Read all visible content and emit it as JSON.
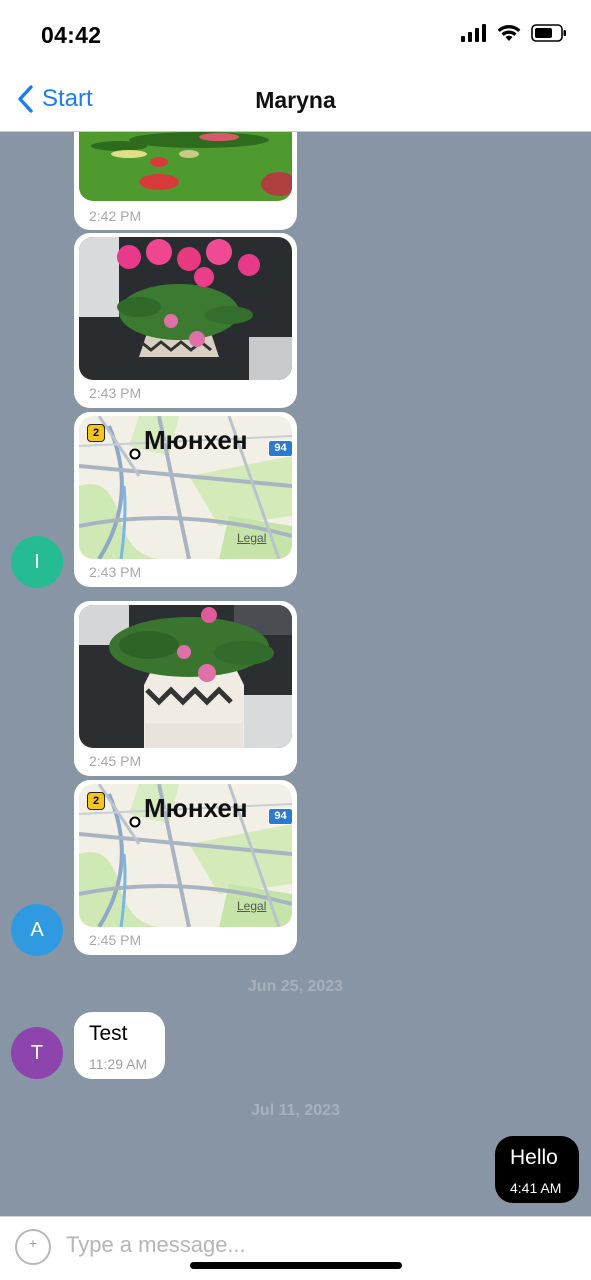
{
  "status_bar": {
    "time": "04:42"
  },
  "nav": {
    "back_label": "Start",
    "title": "Maryna"
  },
  "messages": [
    {
      "kind": "image-park",
      "time": "2:42 PM"
    },
    {
      "kind": "image-flower",
      "time": "2:43 PM"
    },
    {
      "kind": "map",
      "map_city": "Мюнхен",
      "map_badge_left": "2",
      "map_badge_right": "94",
      "map_legal": "Legal",
      "time": "2:43 PM"
    },
    {
      "kind": "image-flower",
      "time": "2:45 PM"
    },
    {
      "kind": "map",
      "map_city": "Мюнхен",
      "map_badge_left": "2",
      "map_badge_right": "94",
      "map_legal": "Legal",
      "time": "2:45 PM"
    }
  ],
  "avatars": [
    {
      "letter": "I",
      "color": "#26bc93"
    },
    {
      "letter": "A",
      "color": "#2f9ae0"
    },
    {
      "letter": "T",
      "color": "#8e44ad"
    }
  ],
  "date_separators": [
    "Jun 25, 2023",
    "Jul 11, 2023"
  ],
  "text_messages": [
    {
      "text": "Test",
      "time": "11:29 AM",
      "direction": "incoming"
    },
    {
      "text": "Hello",
      "time": "4:41 AM",
      "direction": "outgoing"
    }
  ],
  "composer": {
    "placeholder": "Type a message...",
    "add_icon": "plus-circle-icon"
  },
  "colors": {
    "chat_background": "#8895a4",
    "accent": "#1a7cf5",
    "outgoing_bubble": "#000000"
  }
}
